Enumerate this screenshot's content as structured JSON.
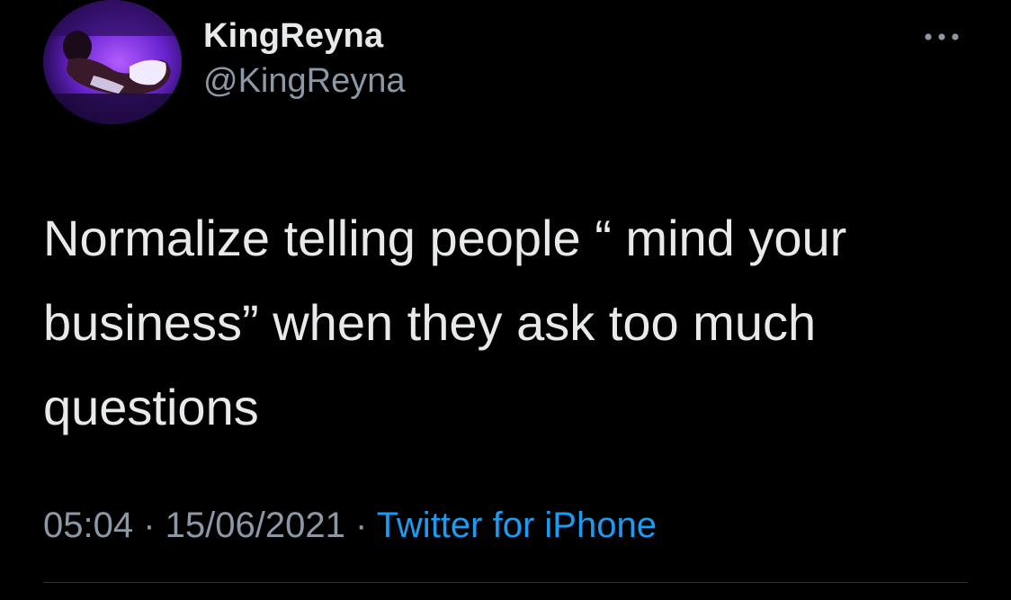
{
  "author": {
    "display_name": "KingReyna",
    "handle": "@KingReyna",
    "avatar_icon": "profile-photo"
  },
  "more_icon": "more-horizontal-icon",
  "tweet": {
    "text": "Normalize telling people “ mind your\nbusiness” when they ask too much\nquestions"
  },
  "meta": {
    "time": "05:04",
    "separator_1": " · ",
    "date": "15/06/2021",
    "separator_2": " · ",
    "source": "Twitter for iPhone"
  },
  "colors": {
    "background": "#000000",
    "text_primary": "#e7e9ea",
    "text_secondary": "#8b98a5",
    "link": "#1d9bf0",
    "divider": "#2f3336"
  }
}
